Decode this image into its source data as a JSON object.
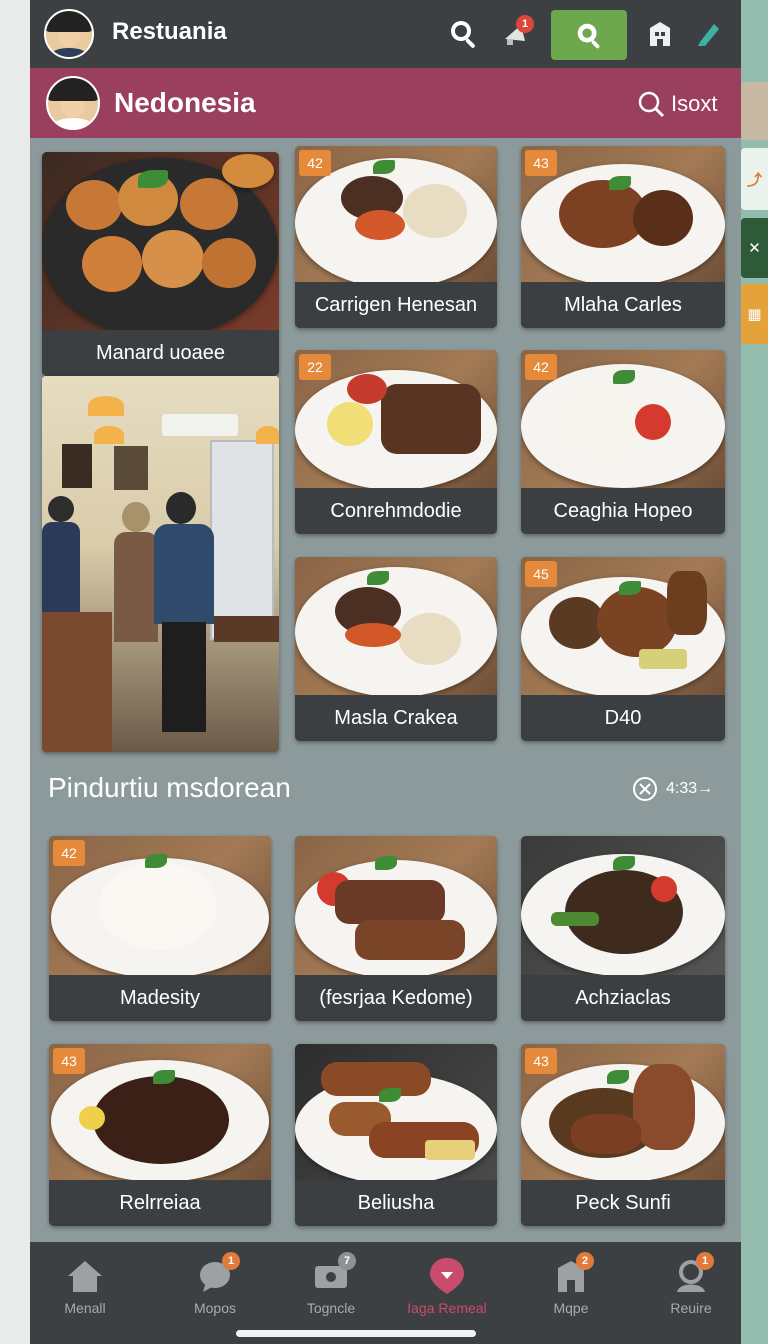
{
  "app": {
    "title": "Restuania"
  },
  "topbar": {
    "notification_count": "1"
  },
  "subheader": {
    "title": "Nedonesia",
    "sort_label": "Isoxt"
  },
  "featured": [
    {
      "name": "Manard uoaee",
      "badge": ""
    },
    {
      "name": "Carrigen Henesan",
      "badge": "42"
    },
    {
      "name": "Mlaha Carles",
      "badge": "43"
    },
    {
      "name": "Conrehmdodie",
      "badge": "22"
    },
    {
      "name": "Ceaghia Hopeo",
      "badge": "42"
    },
    {
      "name": "Masla Crakea",
      "badge": ""
    },
    {
      "name": "D40",
      "badge": "45"
    }
  ],
  "section": {
    "title": "Pindurtiu msdorean",
    "action_label": "4:33→"
  },
  "section_items": [
    {
      "name": "Madesity",
      "badge": "42"
    },
    {
      "name": "(fesrjaa Kedome)",
      "badge": ""
    },
    {
      "name": "Achziaclas",
      "badge": ""
    },
    {
      "name": "Relrreiaa",
      "badge": "43"
    },
    {
      "name": "Beliusha",
      "badge": ""
    },
    {
      "name": "Peck Sunfi",
      "badge": "43"
    }
  ],
  "bottom_nav": [
    {
      "label": "Menall",
      "icon": "home-icon",
      "badge": ""
    },
    {
      "label": "Mopos",
      "icon": "chat-icon",
      "badge": "1"
    },
    {
      "label": "Togncle",
      "icon": "ticket-icon",
      "badge": "7"
    },
    {
      "label": "Iaga Remeal",
      "icon": "location-pin-icon",
      "badge": "",
      "active": true
    },
    {
      "label": "Mqpe",
      "icon": "store-icon",
      "badge": "2"
    },
    {
      "label": "Reuire",
      "icon": "profile-icon",
      "badge": "1"
    }
  ],
  "colors": {
    "header_bg": "#3d4042",
    "subheader_bg": "#9b3f5e",
    "accent_green": "#6ea84e",
    "badge_orange": "#e58a3a",
    "active_nav": "#c94c6e"
  }
}
